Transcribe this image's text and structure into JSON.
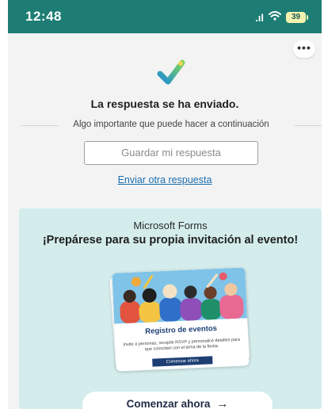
{
  "status_bar": {
    "time": "12:48",
    "signal_glyph": ".ıl",
    "battery": "39"
  },
  "header": {
    "more_label": "•••"
  },
  "confirmation": {
    "title": "La respuesta se ha enviado.",
    "subtitle": "Algo importante que puede hacer a continuación",
    "save_button": "Guardar mi respuesta",
    "send_another_link": "Enviar otra respuesta"
  },
  "promo": {
    "brand": "Microsoft Forms",
    "headline": "¡Prepárese para su propia invitación al evento!",
    "card": {
      "title": "Registro de eventos",
      "description": "Invite a personas, recopile RSVP y personalice detalles para que coincidan con el tema de la fiesta.",
      "cta": "Comenzar ahora"
    },
    "start_button": "Comenzar ahora",
    "start_arrow": "→"
  },
  "colors": {
    "status_bar": "#1d7d74",
    "promo_background": "#d4ecec",
    "link": "#1a6fb0",
    "card_title": "#1d3f73"
  },
  "icons": {
    "check": "check-icon",
    "wifi": "wifi-icon",
    "battery": "battery-icon",
    "more": "more-icon",
    "arrow": "arrow-right-icon"
  }
}
